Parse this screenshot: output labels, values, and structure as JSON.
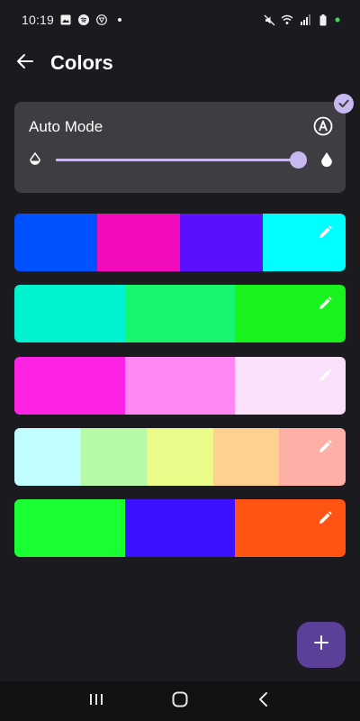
{
  "status_bar": {
    "time": "10:19",
    "left_icons": [
      "image-icon",
      "spotify-icon",
      "shield-icon",
      "dot-icon"
    ],
    "right_icons": [
      "mute-icon",
      "wifi-icon",
      "signal-icon",
      "battery-icon",
      "green-dot-icon"
    ]
  },
  "app_bar": {
    "title": "Colors",
    "back_icon": "arrow-left-icon"
  },
  "auto_mode_card": {
    "label": "Auto Mode",
    "icon": "auto-a-circle-icon",
    "selected": true,
    "brightness_slider_value": 0.98,
    "low_icon": "drop-outline-icon",
    "high_icon": "drop-filled-icon"
  },
  "palettes": [
    {
      "colors": [
        "#0051ff",
        "#f20bbb",
        "#5a10ff",
        "#00ffff"
      ],
      "edit_icon": "pencil-icon"
    },
    {
      "colors": [
        "#00f2cf",
        "#18f56f",
        "#18f21d"
      ],
      "edit_icon": "pencil-icon"
    },
    {
      "colors": [
        "#ff23e6",
        "#ff88f4",
        "#fae0fb"
      ],
      "edit_icon": "pencil-icon"
    },
    {
      "colors": [
        "#c1fdfd",
        "#b6f9a6",
        "#ebfb8a",
        "#fed28e",
        "#ffb0a6"
      ],
      "edit_icon": "pencil-icon"
    },
    {
      "colors": [
        "#1aff31",
        "#3d11ff",
        "#ff5414"
      ],
      "edit_icon": "pencil-icon"
    }
  ],
  "fab": {
    "icon": "plus-icon",
    "color": "#5b3f99"
  },
  "nav_bar": {
    "items": [
      "recents-icon",
      "home-icon",
      "back-icon"
    ]
  },
  "colors": {
    "background": "#1b1a1f",
    "card": "#3e3d42",
    "accent": "#c7b8f0"
  }
}
